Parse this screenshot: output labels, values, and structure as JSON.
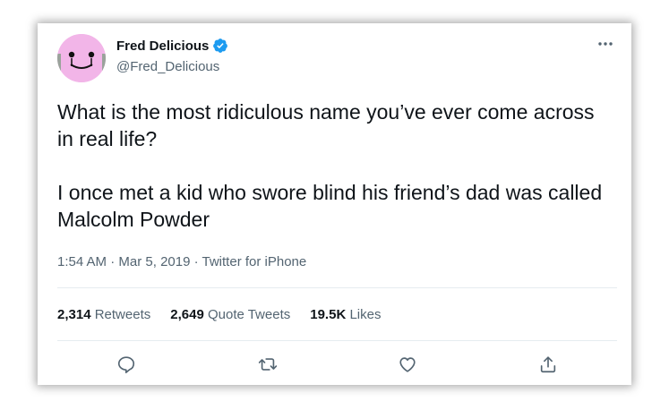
{
  "tweet": {
    "author": {
      "display_name": "Fred Delicious",
      "handle": "@Fred_Delicious",
      "verified": true
    },
    "text": {
      "line1": "What is the most ridiculous name you’ve ever come across in real life?",
      "line2": "I once met a kid who swore blind his friend’s dad was called Malcolm Powder"
    },
    "time": "1:54 AM",
    "sep1": "·",
    "date": "Mar 5, 2019",
    "sep2": "·",
    "source": "Twitter for iPhone"
  },
  "stats": {
    "retweets": {
      "count": "2,314",
      "label": "Retweets"
    },
    "quote_tweets": {
      "count": "2,649",
      "label": "Quote Tweets"
    },
    "likes": {
      "count": "19.5K",
      "label": "Likes"
    }
  },
  "actions": [
    "reply-icon",
    "retweet-icon",
    "like-icon",
    "share-icon"
  ],
  "colors": {
    "text": "#0f1419",
    "secondary": "#536471",
    "verified": "#1d9bf0",
    "avatar_bg": "#f2b5e8",
    "divider": "#e6ecf0"
  }
}
